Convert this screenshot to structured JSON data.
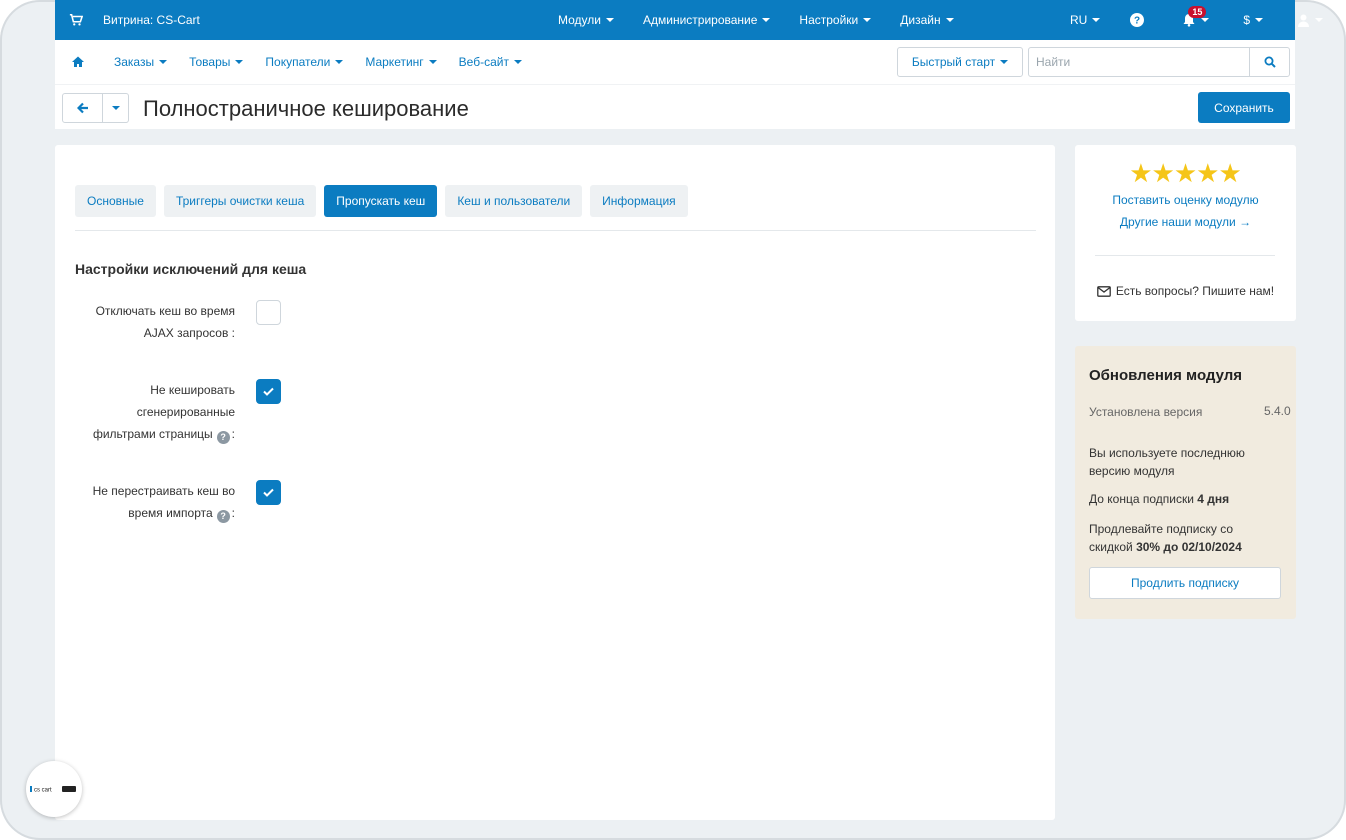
{
  "topbar": {
    "store_label": "Витрина: CS-Cart",
    "menu": [
      "Модули",
      "Администрирование",
      "Настройки",
      "Дизайн"
    ],
    "language": "RU",
    "currency": "$",
    "notifications_count": "15"
  },
  "nav": {
    "items": [
      "Заказы",
      "Товары",
      "Покупатели",
      "Маркетинг",
      "Веб-сайт"
    ],
    "quick_start": "Быстрый старт",
    "search_placeholder": "Найти"
  },
  "page": {
    "title": "Полностраничное кеширование",
    "save_label": "Сохранить"
  },
  "tabs": [
    {
      "label": "Основные",
      "active": false
    },
    {
      "label": "Триггеры очистки кеша",
      "active": false
    },
    {
      "label": "Пропускать кеш",
      "active": true
    },
    {
      "label": "Кеш и пользователи",
      "active": false
    },
    {
      "label": "Информация",
      "active": false
    }
  ],
  "section": {
    "title": "Настройки исключений для кеша",
    "fields": [
      {
        "label": "Отключать кеш во время AJAX запросов :",
        "checked": false
      },
      {
        "label": "Не кешировать сгенерированные фильтрами страницы",
        "suffix": ":",
        "checked": true
      },
      {
        "label": "Не перестраивать кеш во время импорта",
        "suffix": ":",
        "checked": true
      }
    ]
  },
  "rating": {
    "stars": 5,
    "rate_link": "Поставить оценку модулю",
    "other_link": "Другие наши модули →",
    "contact": "Есть вопросы? Пишите нам!"
  },
  "updates": {
    "title": "Обновления модуля",
    "installed_label": "Установлена версия",
    "installed_version": "5.4.0",
    "latest_note": "Вы используете последнюю версию модуля",
    "subscription_prefix": "До конца подписки",
    "subscription_days": "4 дня",
    "discount_prefix": "Продлевайте подписку со скидкой",
    "discount_value": "30% до 02/10/2024",
    "renew_button": "Продлить подписку"
  },
  "logo": {
    "text": "cs cart"
  },
  "colors": {
    "accent": "#0b7cc1",
    "star": "#f5c518",
    "updates_bg": "#f1ebdf"
  }
}
